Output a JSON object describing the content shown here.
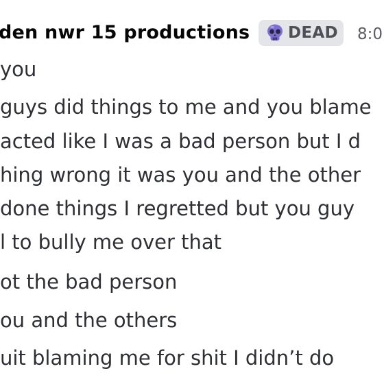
{
  "header": {
    "username": "den nwr 15 productions",
    "tag_label": "DEAD",
    "tag_icon": "skull-icon",
    "timestamp": "8:0"
  },
  "messages": [
    " you",
    "guys did things to me and you blame",
    "acted like I was a bad person but I d",
    "hing wrong it was you and the other",
    " done things I regretted but you guy",
    "l to bully me over that",
    "ot the bad person",
    "ou and the others",
    "uit blaming me for shit I didn’t do"
  ],
  "colors": {
    "username": "#060607",
    "message_text": "#2e3035",
    "tag_background": "#e3e5e8",
    "tag_text": "#4e5058",
    "skull": "#7b6fd6",
    "timestamp": "#5c5e66"
  }
}
